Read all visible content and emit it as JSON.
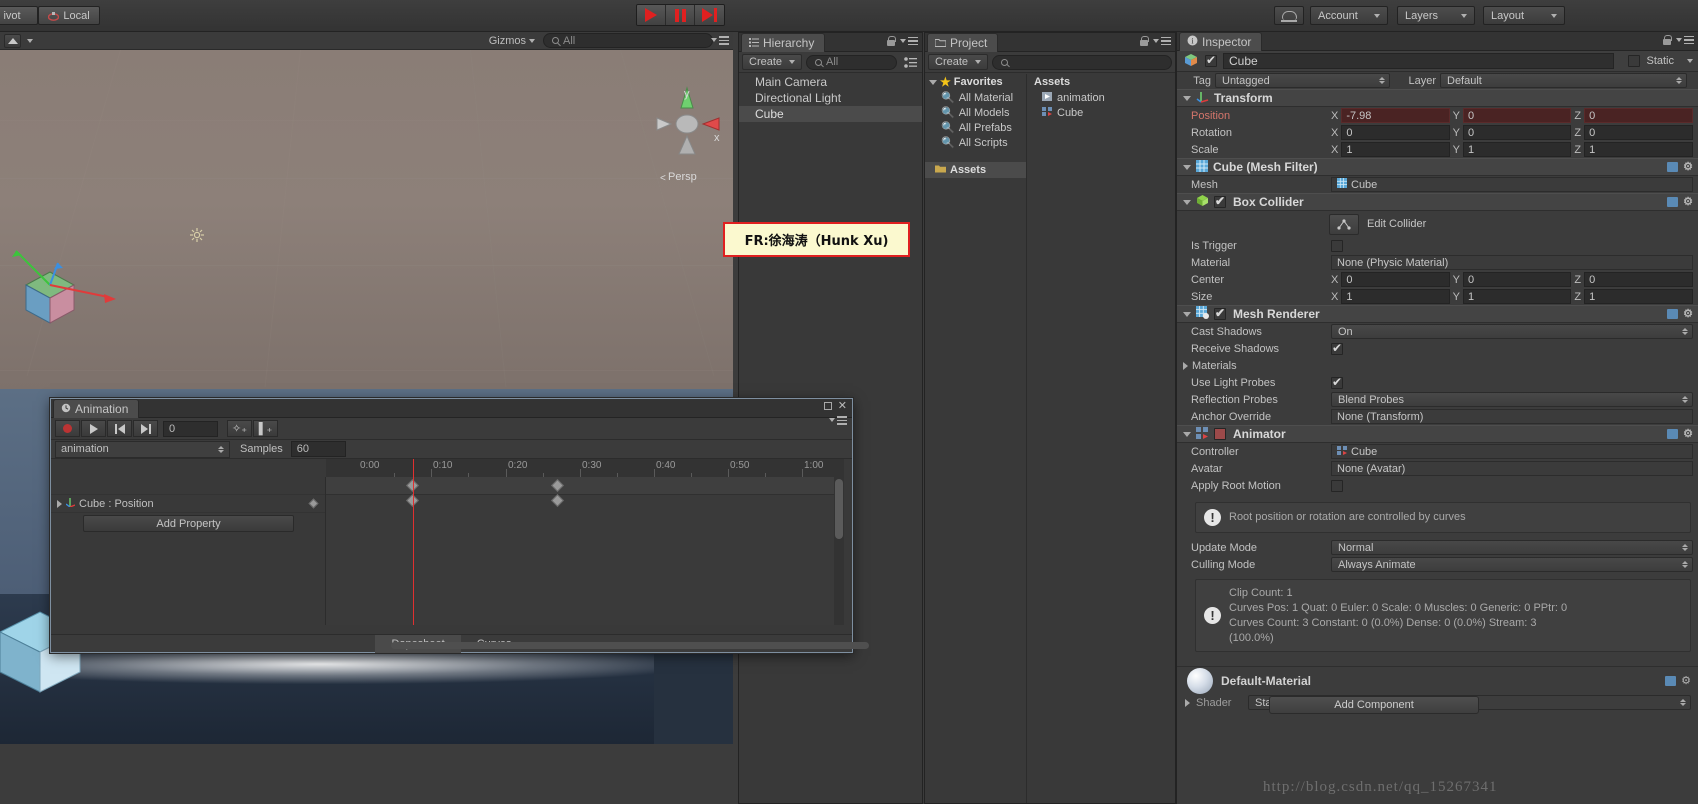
{
  "toolbar": {
    "pivot_label": "ivot",
    "local_label": "Local",
    "play_label": "play-button",
    "pause_label": "pause-button",
    "step_label": "step-button",
    "cloud_label": "cloud-services",
    "account_label": "Account",
    "layers_label": "Layers",
    "layout_label": "Layout"
  },
  "scene_view": {
    "gizmos_label": "Gizmos",
    "search_placeholder": "All",
    "axis_y": "y",
    "axis_x": "x",
    "persp_label": "Persp"
  },
  "annotation": {
    "note": "FR:徐海涛（Hunk Xu)"
  },
  "hierarchy": {
    "tab_label": "Hierarchy",
    "create_label": "Create",
    "search_placeholder": "All",
    "items": [
      {
        "label": "Main Camera",
        "selected": false
      },
      {
        "label": "Directional Light",
        "selected": false
      },
      {
        "label": "Cube",
        "selected": true
      }
    ]
  },
  "project": {
    "tab_label": "Project",
    "create_label": "Create",
    "search_placeholder": "",
    "favorites_label": "Favorites",
    "favorites": [
      "All Material",
      "All Models",
      "All Prefabs",
      "All Scripts"
    ],
    "assets_root_label": "Assets",
    "assets_col_label": "Assets",
    "assets": [
      {
        "label": "animation",
        "icon": "animation-clip-icon"
      },
      {
        "label": "Cube",
        "icon": "animator-controller-icon"
      }
    ]
  },
  "animation_window": {
    "tab_label": "Animation",
    "record_label": "record-button",
    "play_label": "play-button",
    "prev_key_label": "prev-keyframe-button",
    "next_key_label": "next-keyframe-button",
    "frame_value": "0",
    "add_keyframe_label": "add-keyframe-button",
    "add_event_label": "add-event-button",
    "clip_name": "animation",
    "samples_label": "Samples",
    "samples_value": "60",
    "property_row": "Cube : Position",
    "add_property_label": "Add Property",
    "timeline_ticks": [
      "0:00",
      "0:10",
      "0:20",
      "0:30",
      "0:40",
      "0:50",
      "1:00"
    ],
    "bottom_tabs": [
      {
        "label": "Dopesheet",
        "active": true
      },
      {
        "label": "Curves",
        "active": false
      }
    ]
  },
  "inspector": {
    "tab_label": "Inspector",
    "static_label": "Static",
    "object_name": "Cube",
    "tag_label": "Tag",
    "tag_value": "Untagged",
    "layer_label": "Layer",
    "layer_value": "Default",
    "components": [
      {
        "name": "Transform",
        "icon": "transform-icon",
        "rows": [
          {
            "label": "Position",
            "animated": true,
            "x": "-7.98",
            "y": "0",
            "z": "0"
          },
          {
            "label": "Rotation",
            "animated": false,
            "x": "0",
            "y": "0",
            "z": "0"
          },
          {
            "label": "Scale",
            "animated": false,
            "x": "1",
            "y": "1",
            "z": "1"
          }
        ]
      },
      {
        "name": "Cube (Mesh Filter)",
        "icon": "mesh-filter-icon",
        "mesh_label": "Mesh",
        "mesh_value": "Cube"
      },
      {
        "name": "Box Collider",
        "icon": "box-collider-icon",
        "edit_collider_label": "Edit Collider",
        "is_trigger_label": "Is Trigger",
        "is_trigger_value": false,
        "material_label": "Material",
        "material_value": "None (Physic Material)",
        "center_label": "Center",
        "center": {
          "x": "0",
          "y": "0",
          "z": "0"
        },
        "size_label": "Size",
        "size": {
          "x": "1",
          "y": "1",
          "z": "1"
        }
      },
      {
        "name": "Mesh Renderer",
        "icon": "mesh-renderer-icon",
        "cast_shadows_label": "Cast Shadows",
        "cast_shadows_value": "On",
        "receive_shadows_label": "Receive Shadows",
        "receive_shadows_value": true,
        "materials_label": "Materials",
        "use_light_probes_label": "Use Light Probes",
        "use_light_probes_value": true,
        "reflection_probes_label": "Reflection Probes",
        "reflection_probes_value": "Blend Probes",
        "anchor_override_label": "Anchor Override",
        "anchor_override_value": "None (Transform)"
      },
      {
        "name": "Animator",
        "icon": "animator-icon",
        "controller_label": "Controller",
        "controller_value": "Cube",
        "avatar_label": "Avatar",
        "avatar_value": "None (Avatar)",
        "apply_root_motion_label": "Apply Root Motion",
        "apply_root_motion_value": false,
        "warning_1": "Root position or rotation are controlled by curves",
        "update_mode_label": "Update Mode",
        "update_mode_value": "Normal",
        "culling_mode_label": "Culling Mode",
        "culling_mode_value": "Always Animate",
        "info_line1": "Clip Count: 1",
        "info_line2": "Curves Pos: 1 Quat: 0 Euler: 0 Scale: 0 Muscles: 0 Generic: 0 PPtr: 0",
        "info_line3": "Curves Count: 3 Constant: 0 (0.0%) Dense: 0 (0.0%) Stream: 3",
        "info_line4": "(100.0%)"
      }
    ],
    "material_name": "Default-Material",
    "shader_label": "Shader",
    "shader_value": "Standard",
    "add_component_label": "Add Component"
  },
  "watermark": {
    "url": "http://blog.csdn.net/qq_15267341"
  }
}
